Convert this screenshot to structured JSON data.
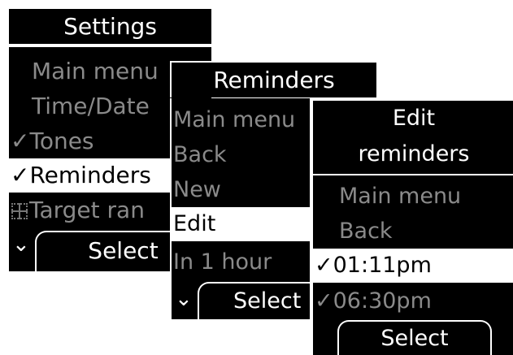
{
  "settings": {
    "title": "Settings",
    "items": [
      {
        "label": "Main menu",
        "state": "dim"
      },
      {
        "label": "Time/Date",
        "state": "dim"
      },
      {
        "label": "Tones",
        "state": "dim",
        "mark": "check"
      },
      {
        "label": "Reminders",
        "state": "selected",
        "mark": "check"
      },
      {
        "label": "Target ran",
        "state": "dim",
        "mark": "grid"
      }
    ],
    "chevron": "⌄",
    "select_label": "Select"
  },
  "reminders": {
    "title": "Reminders",
    "items": [
      {
        "label": "Main menu",
        "state": "dim"
      },
      {
        "label": "Back",
        "state": "dim"
      },
      {
        "label": "New",
        "state": "dim"
      },
      {
        "label": "Edit",
        "state": "selected"
      },
      {
        "label": "In 1 hour",
        "state": "dim"
      }
    ],
    "chevron": "⌄",
    "select_label": "Select"
  },
  "edit_reminders": {
    "title_line1": "Edit",
    "title_line2": "reminders",
    "items": [
      {
        "label": "Main menu",
        "state": "dim"
      },
      {
        "label": "Back",
        "state": "dim"
      },
      {
        "label": "01:11pm",
        "state": "selected",
        "mark": "check"
      },
      {
        "label": "06:30pm",
        "state": "dim",
        "mark": "check"
      }
    ],
    "select_label": "Select"
  },
  "check_glyph": "✓"
}
